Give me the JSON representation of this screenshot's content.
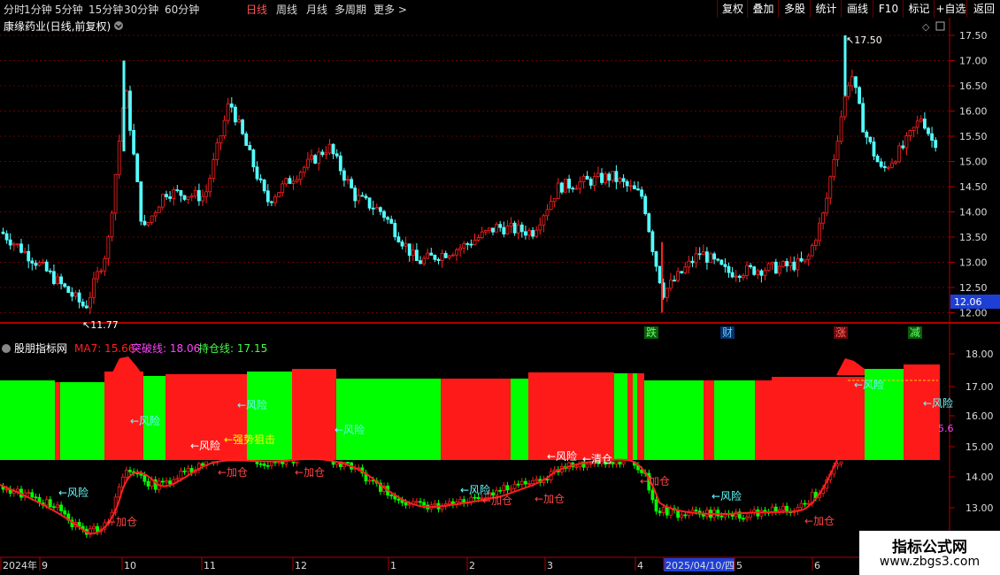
{
  "toolbar": {
    "periods": [
      "分时",
      "1分钟",
      "5分钟",
      "15分钟",
      "30分钟",
      "60分钟",
      "日线",
      "周线",
      "月线",
      "多周期",
      "更多 >"
    ],
    "active_period": "日线",
    "actions": [
      "复权",
      "叠加",
      "多股",
      "统计",
      "画线",
      "F10",
      "标记",
      "+自选",
      "返回"
    ]
  },
  "main_title": "康缘药业(日线,前复权)",
  "price_axis": [
    "17.50",
    "17.00",
    "16.50",
    "16.00",
    "15.50",
    "15.00",
    "14.50",
    "14.00",
    "13.50",
    "13.00",
    "12.50",
    "12.00"
  ],
  "current_price": "12.06",
  "annotations": {
    "high": "17.50",
    "low": "11.77",
    "events": [
      "跌",
      "财",
      "涨",
      "减"
    ]
  },
  "indicator": {
    "name": "股朋指标网",
    "ma7": "MA7: 15.66",
    "break_line": "突破线: 18.06",
    "hold_line": "持仓线: 17.15",
    "axis": [
      "18.00",
      "17.00",
      "16.00",
      "15.00",
      "14.00",
      "13.00"
    ],
    "right_value": "5.6",
    "labels": {
      "risk": "←风险",
      "add": "←加仓",
      "clear": "←清仓",
      "strong": "←强势狙击"
    }
  },
  "date_axis": [
    "2024年",
    "9",
    "10",
    "11",
    "12",
    "1",
    "2",
    "3",
    "4",
    "2025/04/10/四",
    "5",
    "6"
  ],
  "watermark": {
    "title": "指标公式网",
    "url": "www.zbgs3.com"
  },
  "colors": {
    "up": "#ff2020",
    "down": "#54ffff",
    "green_band": "#00ff00",
    "red_band": "#ff1a1a",
    "grid": "#8b0000"
  }
}
